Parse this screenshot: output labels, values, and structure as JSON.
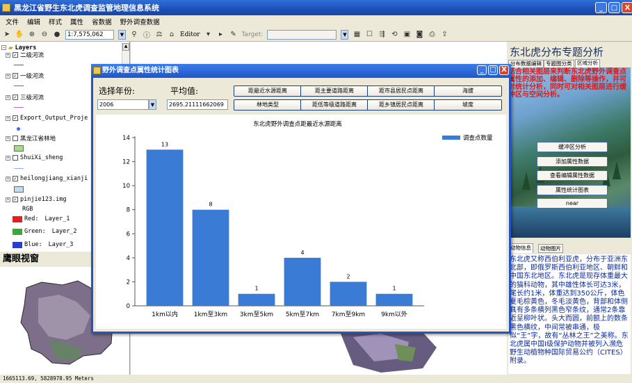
{
  "app": {
    "title": "黑龙江省野生东北虎调查监管地理信息系统",
    "window_buttons": [
      "_",
      "□",
      "X"
    ]
  },
  "menu": [
    "文件",
    "编辑",
    "样式",
    "属性",
    "省数据",
    "野外调查数据"
  ],
  "toolbar": {
    "scale": "1:7,575,062",
    "editor_label": "Editor",
    "target_label": "Target:",
    "target_value": ""
  },
  "toc": {
    "root": "Layers",
    "layers": [
      {
        "name": "二级河流",
        "checked": true,
        "symbol": "line",
        "color": "#3b5fd6"
      },
      {
        "name": "一级河流",
        "checked": true,
        "symbol": "line",
        "color": "#cc3a8a"
      },
      {
        "name": "三级河流",
        "checked": true,
        "symbol": "line",
        "color": "#b06ad0"
      },
      {
        "name": "Export_Output_Proje",
        "checked": true,
        "symbol": "dot",
        "color": "#3d6bd8"
      },
      {
        "name": "黑龙江省林地",
        "checked": false,
        "symbol": "box",
        "color": "#a9d98c"
      },
      {
        "name": "ShuiXi_sheng",
        "checked": false,
        "symbol": "line",
        "color": "#8fb3e8"
      },
      {
        "name": "heilongjiang_xianji",
        "checked": true,
        "symbol": "box",
        "color": "#c2dcf2"
      },
      {
        "name": "pinjie123.img",
        "checked": true,
        "symbol": "raster",
        "color": ""
      }
    ],
    "raster_label": "RGB",
    "bands": [
      {
        "label": "Red:",
        "value": "Layer_1",
        "color": "#e02020"
      },
      {
        "label": "Green:",
        "value": "Layer_2",
        "color": "#3aa83a"
      },
      {
        "label": "Blue:",
        "value": "Layer_3",
        "color": "#2a3fc8"
      }
    ]
  },
  "eagle_eye": {
    "title": "鹰眼视窗"
  },
  "status": {
    "coords": "1665113.69, 5828978.95 Meters"
  },
  "right_panel": {
    "title": "东北虎分布专题分析",
    "tabs": [
      "分布数据编辑",
      "专题图分类",
      "区域分析"
    ],
    "active_tab": 2,
    "instruction": "结合相关图层来判断东北虎野外调查点属性的添加、编辑、删除等操作，并可对统计分析，同时可对相关图层进行缓冲区与空间分析。",
    "buttons": [
      "缓冲区分析",
      "添加属性数据",
      "查看编辑属性数据",
      "属性统计图表",
      "near"
    ],
    "bottom_tabs": [
      "动物信息",
      "动物图片"
    ],
    "description": "东北虎又称西伯利亚虎，分布于亚洲东北部，即俄罗斯西伯利亚地区、朝鲜和中国东北地区。东北虎是现存体重最大的猫科动物，其中雄性体长可达3米，尾长约1米，体重达到350公斤，体色夏毛棕黄色，冬毛淡黄色，背部和体侧具有多条横列黑色窄条纹，通常2条靠近呈柳叶状。头大而圆，前额上的数条黑色横纹，中间常被串通，极似“王”字，故有“丛林之王”之美称。东北虎属中国Ⅰ级保护动物并被列入濒危野生动植物种国际贸易公约（CITES）附录。"
  },
  "dialog": {
    "title": "野外调查点属性统计图表",
    "year_label": "选择年份:",
    "year_value": "2006",
    "avg_label": "平均值:",
    "avg_value": "2695.21111662069",
    "buttons_row1": [
      "距最近水源距离",
      "距主要道路距离",
      "距市县居民点距离",
      "海拔"
    ],
    "buttons_row2": [
      "林地类型",
      "距低等级道路距离",
      "距乡镇居民点距离",
      "坡度"
    ]
  },
  "chart_data": {
    "type": "bar",
    "title": "东北虎野外调查点距最近水源距离",
    "categories": [
      "1km以内",
      "1km至3km",
      "3km至5km",
      "5km至7km",
      "7km至9km",
      "9km以外"
    ],
    "series": [
      {
        "name": "调查点数量",
        "values": [
          13,
          8,
          1,
          4,
          2,
          1
        ],
        "color": "#3a7bd5"
      }
    ],
    "ylim": [
      0,
      14
    ],
    "yticks": [
      0,
      2,
      4,
      6,
      8,
      10,
      12,
      14
    ],
    "legend": "top-right",
    "grid": false
  }
}
